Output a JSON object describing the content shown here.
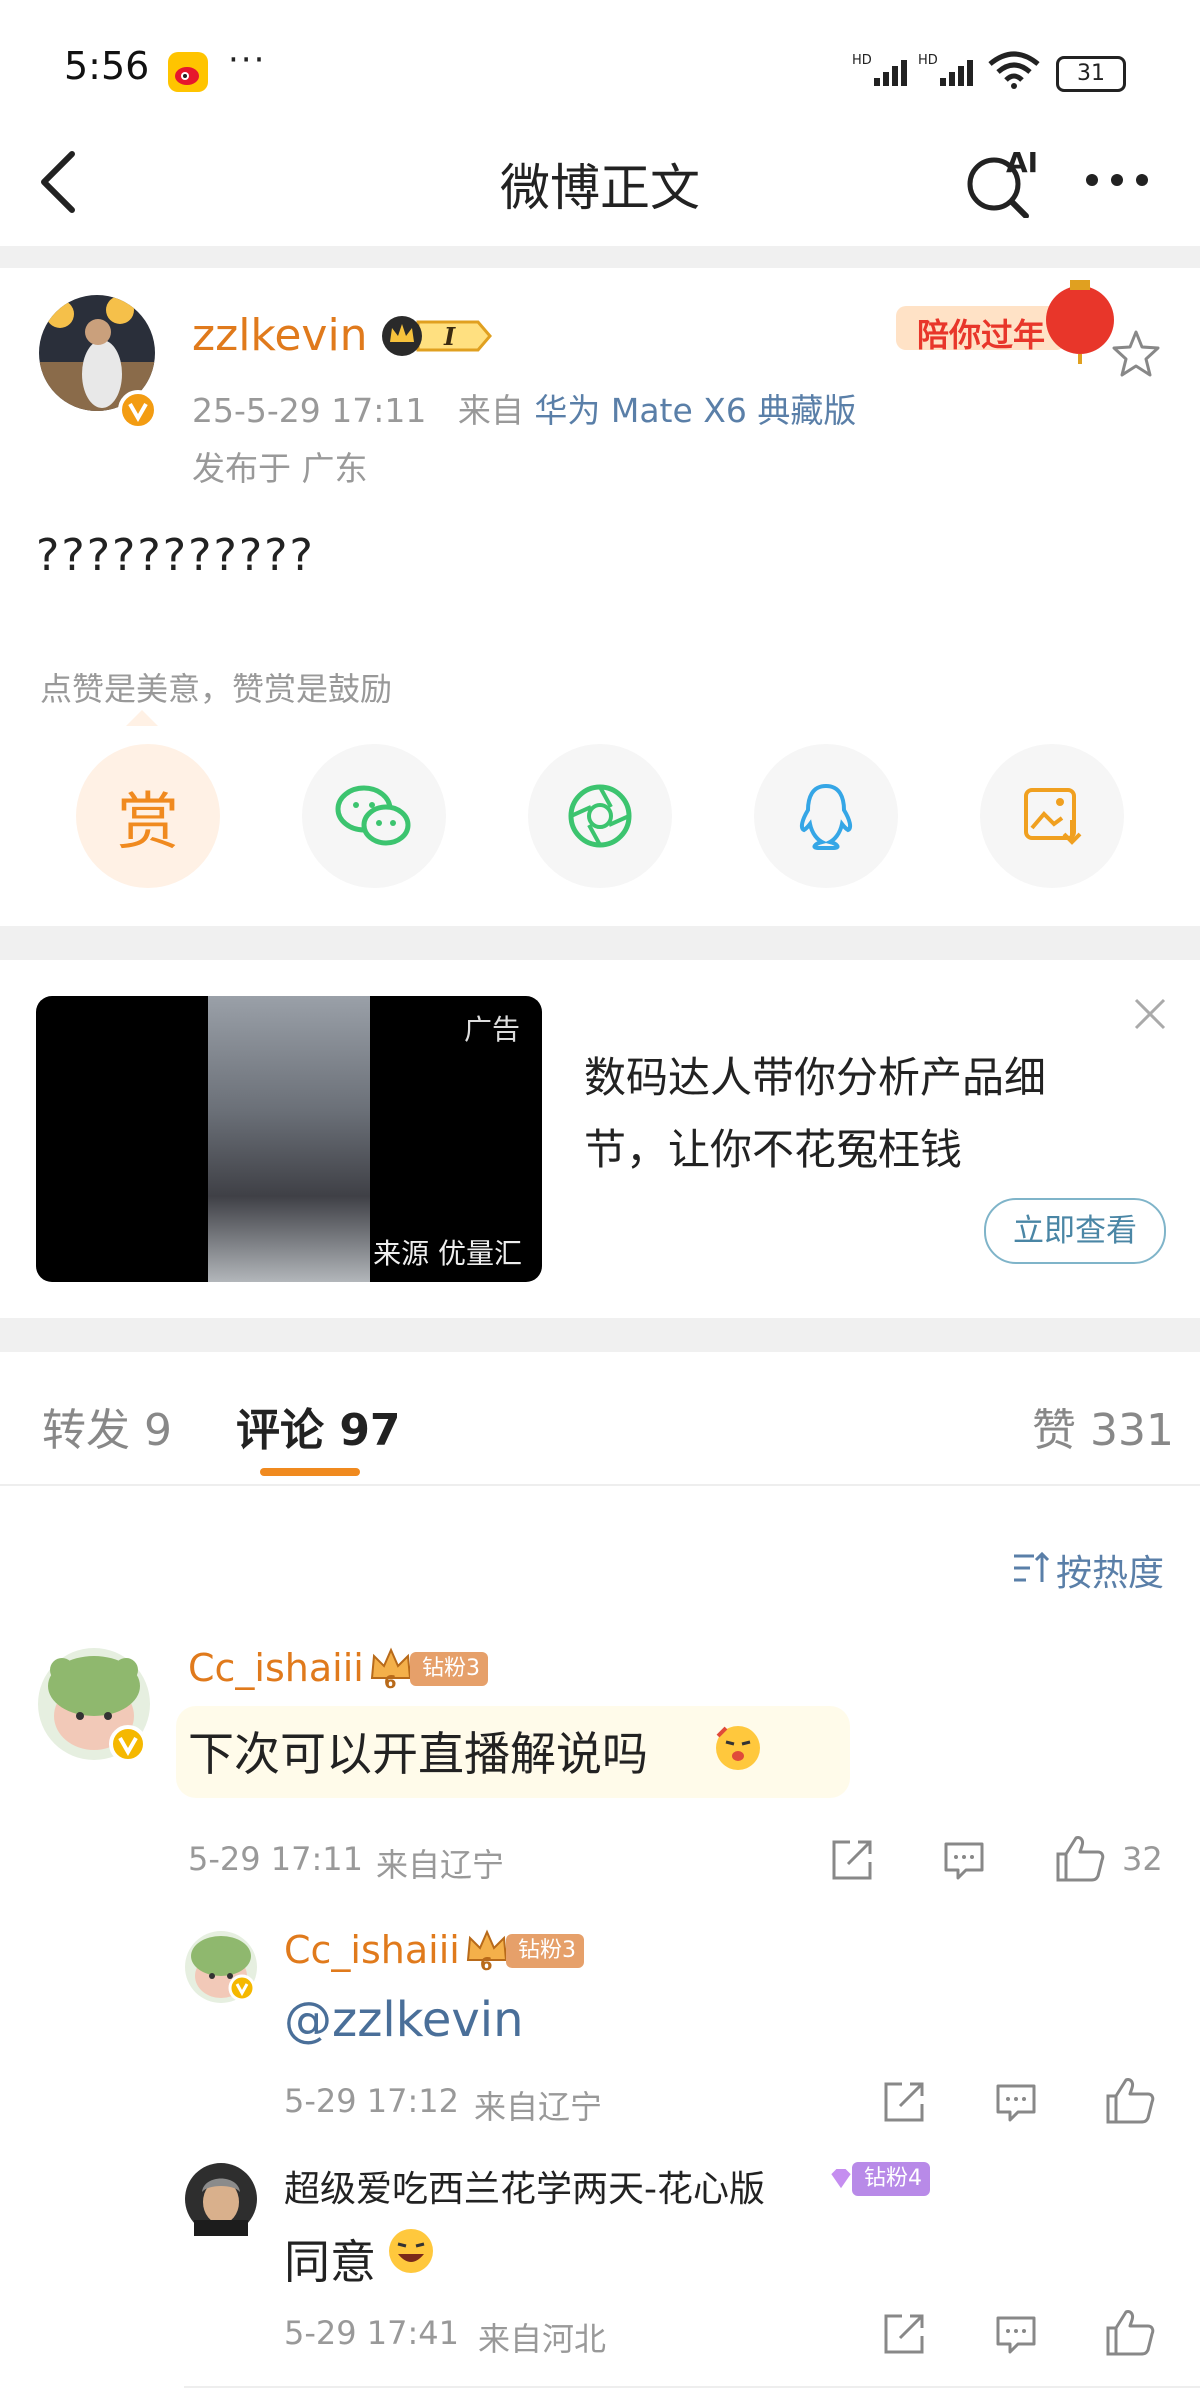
{
  "status_bar": {
    "time": "5:56",
    "dots": "···",
    "battery": "31"
  },
  "nav": {
    "title": "微博正文"
  },
  "post": {
    "author": "zzlkevin",
    "member_badge_text": "I",
    "promo_banner": "陪你过年",
    "date": "25-5-29 17:11",
    "source_prefix": "来自",
    "device": "华为 Mate X6 典藏版",
    "location": "发布于 广东",
    "text": "???????????",
    "reward_hint": "点赞是美意，赞赏是鼓励",
    "reward_label": "赏"
  },
  "ad": {
    "badge": "广告",
    "source": "来源 优量汇",
    "text": "数码达人带你分析产品细节，让你不花冤枉钱",
    "cta": "立即查看"
  },
  "tabs": {
    "reposts": "转发 9",
    "comments": "评论 97",
    "likes": "赞 331"
  },
  "sort": {
    "label": "按热度"
  },
  "comments": [
    {
      "user": "Cc_ishaiii",
      "badge": "钻粉3",
      "text": "下次可以开直播解说吗",
      "time": "5-29 17:11",
      "location": "来自辽宁",
      "likes": "32"
    }
  ],
  "replies": [
    {
      "user": "Cc_ishaiii",
      "badge": "钻粉3",
      "text": "@zzlkevin",
      "time": "5-29 17:12",
      "location": "来自辽宁"
    },
    {
      "user": "超级爱吃西兰花学两天-花心版",
      "badge": "钻粉4",
      "text": "同意",
      "time": "5-29 17:41",
      "location": "来自河北"
    }
  ],
  "colors": {
    "accent_orange": "#f08a1f",
    "name_orange": "#e07a1c",
    "link_blue": "#5a7fa8",
    "fan_badge_orange": "#e6a06a",
    "fan_badge_purple": "#b88ae8"
  }
}
